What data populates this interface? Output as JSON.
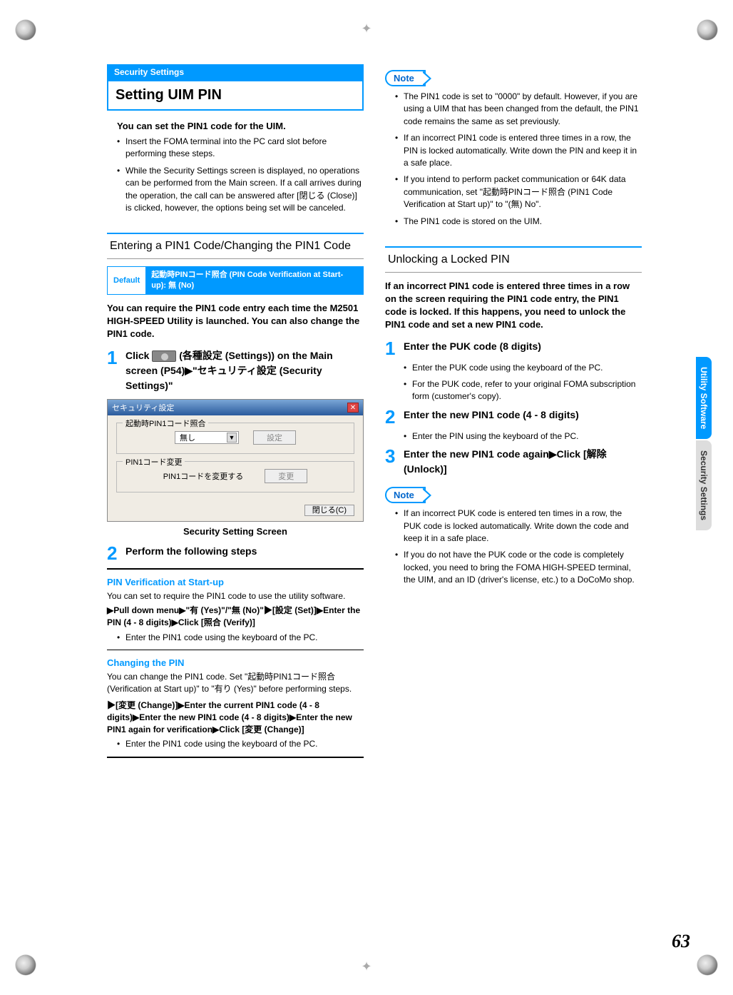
{
  "page_number": "63",
  "side_tabs": {
    "utility": "Utility Software",
    "security": "Security Settings"
  },
  "left": {
    "section_label": "Security Settings",
    "title": "Setting UIM PIN",
    "intro": "You can set the PIN1 code for the UIM.",
    "intro_bullets": [
      "Insert the FOMA terminal into the PC card slot before performing these steps.",
      "While the Security Settings screen is displayed, no operations can be performed from the Main screen. If a call arrives during the operation, the call can be answered after [閉じる (Close)] is clicked, however, the options being set will be canceled."
    ],
    "subhead1": "Entering a PIN1 Code/Changing the PIN1 Code",
    "default_label": "Default",
    "default_value": "起動時PINコード照合 (PIN Code Verification at Start-up): 無 (No)",
    "body1": "You can require the PIN1 code entry each time the M2501 HIGH-SPEED Utility is launched. You can also change the PIN1 code.",
    "step1_pre": "Click ",
    "step1_post": " (各種設定 (Settings)) on the Main screen (P54)▶\"セキュリティ設定 (Security Settings)\"",
    "dialog": {
      "title": "セキュリティ設定",
      "group1": "起動時PIN1コード照合",
      "combo_value": "無し",
      "btn_set": "設定",
      "group2": "PIN1コード変更",
      "group2_text": "PIN1コードを変更する",
      "btn_change": "変更",
      "btn_close": "閉じる(C)"
    },
    "caption": "Security Setting Screen",
    "step2": "Perform the following steps",
    "pv_head": "PIN Verification at Start-up",
    "pv_text": "You can set to require the PIN1 code to use the utility software.",
    "pv_flow": "▶Pull down menu▶\"有 (Yes)\"/\"無 (No)\"▶[設定 (Set)]▶Enter the PIN (4 - 8 digits)▶Click [照合 (Verify)]",
    "pv_bullet": "Enter the PIN1 code using the keyboard of the PC.",
    "cp_head": "Changing the PIN",
    "cp_text": "You can change the PIN1 code. Set \"起動時PIN1コード照合 (Verification at Start up)\" to \"有り (Yes)\" before performing steps.",
    "cp_flow": "▶[変更 (Change)]▶Enter the current PIN1 code (4 - 8 digits)▶Enter the new PIN1 code (4 - 8 digits)▶Enter the new PIN1 again for verification▶Click [変更 (Change)]",
    "cp_bullet": "Enter the PIN1 code using the keyboard of the PC."
  },
  "right": {
    "note_label": "Note",
    "note1_bullets": [
      "The PIN1 code is set to \"0000\" by default. However, if you are using a UIM that has been changed from the default, the PIN1 code remains the same as set previously.",
      "If an incorrect PIN1 code is entered three times in a row, the PIN is locked automatically. Write down the PIN and keep it in a safe place.",
      "If you intend to perform packet communication or 64K data communication, set \"起動時PINコード照合 (PIN1 Code Verification at Start up)\" to \"(無) No\".",
      "The PIN1 code is stored on the UIM."
    ],
    "subhead": "Unlocking a Locked PIN",
    "body": "If an incorrect PIN1 code is entered three times in a row on the screen requiring the PIN1 code entry, the PIN1 code is locked. If this happens, you need to unlock the PIN1 code and set a new PIN1 code.",
    "step1": "Enter the PUK code (8 digits)",
    "step1_bullets": [
      "Enter the PUK code using the keyboard of the PC.",
      "For the PUK code, refer to your original FOMA subscription form (customer's copy)."
    ],
    "step2": "Enter the new PIN1 code (4 - 8 digits)",
    "step2_bullet": "Enter the PIN using the keyboard of the PC.",
    "step3": "Enter the new PIN1 code again▶Click [解除 (Unlock)]",
    "note2_bullets": [
      "If an incorrect PUK code is entered ten times in a row, the PUK code is locked automatically. Write down the code and keep it in a safe place.",
      "If you do not have the PUK code or the code is completely locked, you need to bring the FOMA HIGH-SPEED terminal, the UIM, and an ID (driver's license, etc.) to a DoCoMo shop."
    ]
  }
}
